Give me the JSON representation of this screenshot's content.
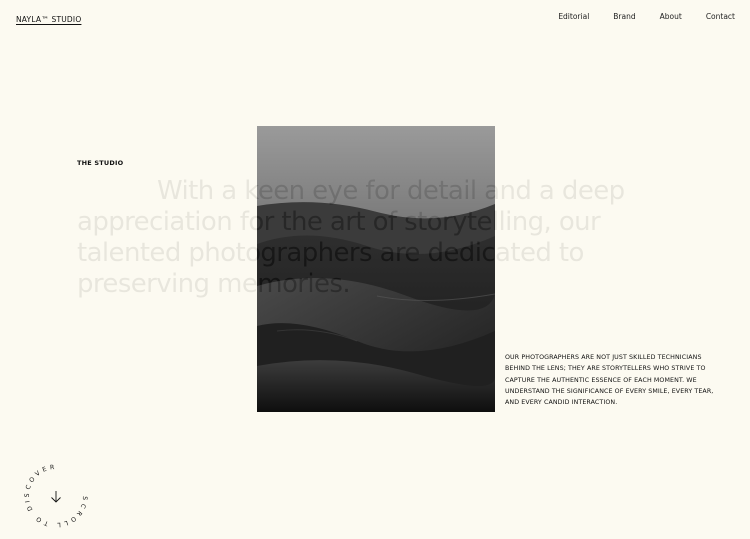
{
  "header": {
    "logo": "NAYLA™ STUDIO",
    "nav": [
      "Editorial",
      "Brand",
      "About",
      "Contact"
    ]
  },
  "studio": {
    "section_label": "THE STUDIO",
    "headline": "With a keen eye for detail and a deep appreciation for the art of storytelling, our talented photographers are dedicated to preserving memories.",
    "body": "OUR PHOTOGRAPHERS ARE NOT JUST SKILLED TECHNICIANS BEHIND THE LENS; THEY ARE STORYTELLERS WHO STRIVE TO CAPTURE THE AUTHENTIC ESSENCE OF EACH MOMENT. WE UNDERSTAND THE SIGNIFICANCE OF EVERY SMILE, EVERY TEAR, AND EVERY CANDID INTERACTION."
  },
  "scroll": {
    "label": "SCROLL TO DISCOVER"
  },
  "colors": {
    "background": "#fcfaf1",
    "text": "#111111"
  },
  "icons": {
    "scroll": "arrow-down-icon"
  }
}
